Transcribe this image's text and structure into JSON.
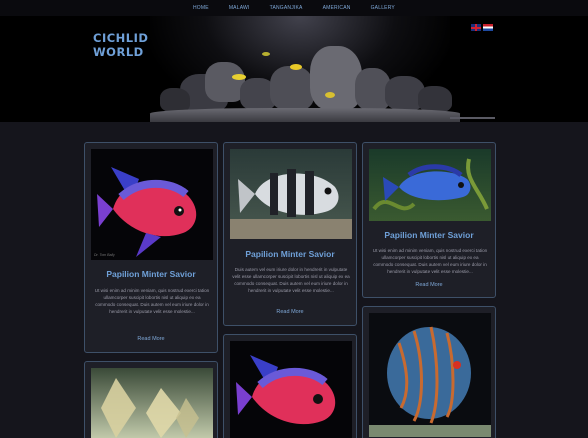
{
  "nav": [
    "HOME",
    "MALAWI",
    "TANGANJIKA",
    "AMERICAN",
    "GALLERY"
  ],
  "brand": {
    "line1": "CICHLID",
    "line2": "WORLD"
  },
  "languages": [
    "english-flag-icon",
    "dutch-flag-icon"
  ],
  "cards": [
    {
      "title": "Papilion Minter Savior",
      "text": "Ut wisi enim ad minim veniam, quis nostrud exerci tation ullamcorper suscipit lobortis nisl ut aliquip ex ea commodo consequat. Duis autem vel eum iriure dolor in hendrerit in vulputate velit esse molestie...",
      "more": "Read More",
      "photo_credit": "Dr. Tom Bally"
    },
    {
      "title": "Papilion Minter Savior",
      "text": "Duis autem vel eum iriure dolor in hendrerit in vulputate velit esse ullamcorper suscipit lobortis nisl ut aliquip ex ea commodo consequat. Duis autem vel eum iriure dolor in hendrerit in vulputate velit esse molestie...",
      "more": "Read More"
    },
    {
      "title": "Papilion Minter Savior",
      "text": "Ut wisi enim ad minim veniam, quis nostrud exerci tation ullamcorper suscipit lobortis nisl ut aliquip ex ea commodo consequat. Duis autem vel eum iriure dolor in hendrerit in vulputate velit esse molestie...",
      "more": "Read More"
    }
  ],
  "colors": {
    "accent": "#6fa0d8",
    "card_border": "#3e5068",
    "background": "#15151c"
  }
}
